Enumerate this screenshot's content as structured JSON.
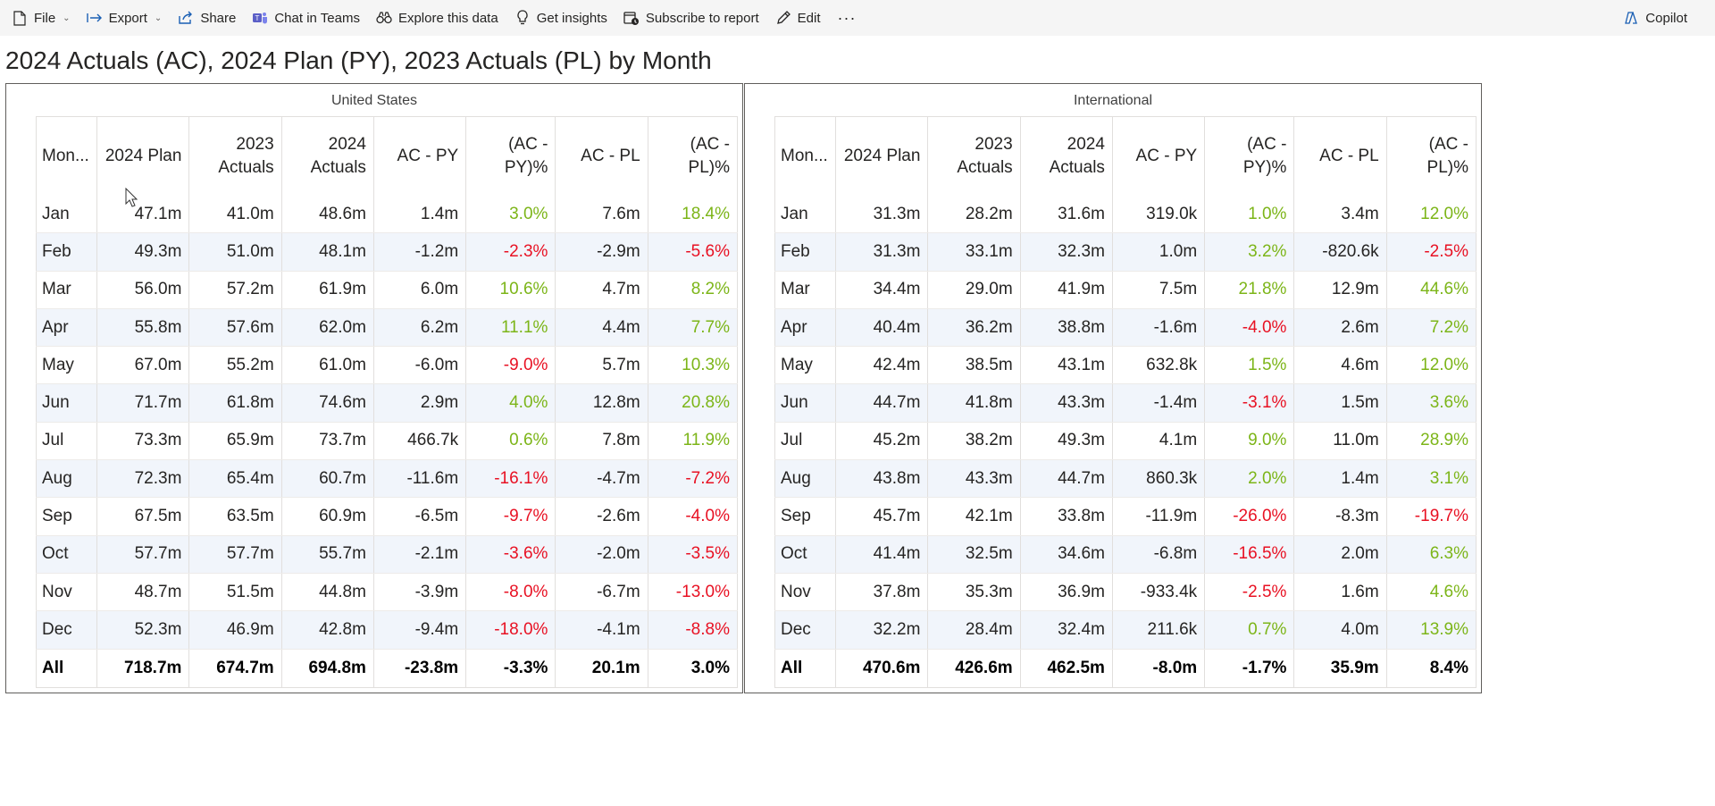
{
  "toolbar": {
    "file": "File",
    "export": "Export",
    "share": "Share",
    "chat": "Chat in Teams",
    "explore": "Explore this data",
    "insights": "Get insights",
    "subscribe": "Subscribe to report",
    "edit": "Edit",
    "more": "···",
    "copilot": "Copilot",
    "icons": [
      "file-icon",
      "export-icon",
      "share-icon",
      "teams-icon",
      "explore-icon",
      "lightbulb-icon",
      "subscribe-icon",
      "edit-icon",
      "more-icon",
      "copilot-icon"
    ]
  },
  "page_title": "2024 Actuals (AC), 2024 Plan (PY), 2023 Actuals (PL) by Month",
  "colors": {
    "positive": "#7cb518",
    "negative": "#e81123",
    "band": "#f1f5fb"
  },
  "headers": [
    "Mon...",
    "2024 Plan",
    "2023 Actuals",
    "2024 Actuals",
    "AC - PY",
    "(AC - PY)%",
    "AC - PL",
    "(AC - PL)%"
  ],
  "tables": [
    {
      "title": "United States",
      "rows": [
        [
          "Jan",
          "47.1m",
          "41.0m",
          "48.6m",
          "1.4m",
          "3.0%",
          "7.6m",
          "18.4%"
        ],
        [
          "Feb",
          "49.3m",
          "51.0m",
          "48.1m",
          "-1.2m",
          "-2.3%",
          "-2.9m",
          "-5.6%"
        ],
        [
          "Mar",
          "56.0m",
          "57.2m",
          "61.9m",
          "6.0m",
          "10.6%",
          "4.7m",
          "8.2%"
        ],
        [
          "Apr",
          "55.8m",
          "57.6m",
          "62.0m",
          "6.2m",
          "11.1%",
          "4.4m",
          "7.7%"
        ],
        [
          "May",
          "67.0m",
          "55.2m",
          "61.0m",
          "-6.0m",
          "-9.0%",
          "5.7m",
          "10.3%"
        ],
        [
          "Jun",
          "71.7m",
          "61.8m",
          "74.6m",
          "2.9m",
          "4.0%",
          "12.8m",
          "20.8%"
        ],
        [
          "Jul",
          "73.3m",
          "65.9m",
          "73.7m",
          "466.7k",
          "0.6%",
          "7.8m",
          "11.9%"
        ],
        [
          "Aug",
          "72.3m",
          "65.4m",
          "60.7m",
          "-11.6m",
          "-16.1%",
          "-4.7m",
          "-7.2%"
        ],
        [
          "Sep",
          "67.5m",
          "63.5m",
          "60.9m",
          "-6.5m",
          "-9.7%",
          "-2.6m",
          "-4.0%"
        ],
        [
          "Oct",
          "57.7m",
          "57.7m",
          "55.7m",
          "-2.1m",
          "-3.6%",
          "-2.0m",
          "-3.5%"
        ],
        [
          "Nov",
          "48.7m",
          "51.5m",
          "44.8m",
          "-3.9m",
          "-8.0%",
          "-6.7m",
          "-13.0%"
        ],
        [
          "Dec",
          "52.3m",
          "46.9m",
          "42.8m",
          "-9.4m",
          "-18.0%",
          "-4.1m",
          "-8.8%"
        ]
      ],
      "total": [
        "All",
        "718.7m",
        "674.7m",
        "694.8m",
        "-23.8m",
        "-3.3%",
        "20.1m",
        "3.0%"
      ]
    },
    {
      "title": "International",
      "rows": [
        [
          "Jan",
          "31.3m",
          "28.2m",
          "31.6m",
          "319.0k",
          "1.0%",
          "3.4m",
          "12.0%"
        ],
        [
          "Feb",
          "31.3m",
          "33.1m",
          "32.3m",
          "1.0m",
          "3.2%",
          "-820.6k",
          "-2.5%"
        ],
        [
          "Mar",
          "34.4m",
          "29.0m",
          "41.9m",
          "7.5m",
          "21.8%",
          "12.9m",
          "44.6%"
        ],
        [
          "Apr",
          "40.4m",
          "36.2m",
          "38.8m",
          "-1.6m",
          "-4.0%",
          "2.6m",
          "7.2%"
        ],
        [
          "May",
          "42.4m",
          "38.5m",
          "43.1m",
          "632.8k",
          "1.5%",
          "4.6m",
          "12.0%"
        ],
        [
          "Jun",
          "44.7m",
          "41.8m",
          "43.3m",
          "-1.4m",
          "-3.1%",
          "1.5m",
          "3.6%"
        ],
        [
          "Jul",
          "45.2m",
          "38.2m",
          "49.3m",
          "4.1m",
          "9.0%",
          "11.0m",
          "28.9%"
        ],
        [
          "Aug",
          "43.8m",
          "43.3m",
          "44.7m",
          "860.3k",
          "2.0%",
          "1.4m",
          "3.1%"
        ],
        [
          "Sep",
          "45.7m",
          "42.1m",
          "33.8m",
          "-11.9m",
          "-26.0%",
          "-8.3m",
          "-19.7%"
        ],
        [
          "Oct",
          "41.4m",
          "32.5m",
          "34.6m",
          "-6.8m",
          "-16.5%",
          "2.0m",
          "6.3%"
        ],
        [
          "Nov",
          "37.8m",
          "35.3m",
          "36.9m",
          "-933.4k",
          "-2.5%",
          "1.6m",
          "4.6%"
        ],
        [
          "Dec",
          "32.2m",
          "28.4m",
          "32.4m",
          "211.6k",
          "0.7%",
          "4.0m",
          "13.9%"
        ]
      ],
      "total": [
        "All",
        "470.6m",
        "426.6m",
        "462.5m",
        "-8.0m",
        "-1.7%",
        "35.9m",
        "8.4%"
      ]
    }
  ]
}
